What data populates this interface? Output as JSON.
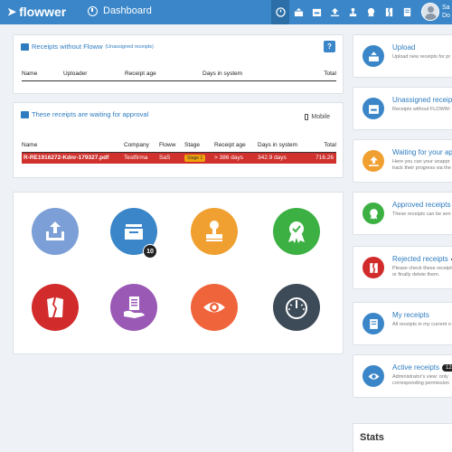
{
  "header": {
    "brand": "flowwer",
    "dashboard_label": "Dashboard",
    "nav_icons": [
      "dashboard-gauge-icon",
      "upload-box-icon",
      "inbox-icon",
      "upload-icon",
      "waiting-stamp-icon",
      "approved-award-icon",
      "rejected-receipt-icon",
      "documents-icon",
      "eye-icon"
    ],
    "user_line1": "Sa",
    "user_line2": "Do",
    "colors": {
      "bar": "#3a86c8",
      "active": "#2c6fa8"
    }
  },
  "unassigned_panel": {
    "title": "Receipts without Floww",
    "subtitle": "(Unassigned receipts)",
    "help_label": "?",
    "columns": [
      "Name",
      "Uploader",
      "Receipt age",
      "Days in system",
      "Total"
    ]
  },
  "approval_panel": {
    "title": "These receipts are waiting for approval",
    "mobile_label": "Mobile",
    "columns": [
      "Name",
      "Company",
      "Floww",
      "Stage",
      "Receipt age",
      "Days in system",
      "Total"
    ],
    "rows": [
      {
        "name": "R-RE1916272-Kdnr-179327.pdf",
        "company": "Testfirma",
        "floww": "SaS",
        "stage": "Stage 1",
        "receipt_age": "> 386 days",
        "days_in_system": "342.9 days",
        "total": "716.26"
      }
    ]
  },
  "circle_icons": [
    {
      "name": "upload",
      "color": "#7b9fd6"
    },
    {
      "name": "unassigned",
      "color": "#3a86c8",
      "badge": "10"
    },
    {
      "name": "waiting-stamp",
      "color": "#f0a030"
    },
    {
      "name": "approved-award",
      "color": "#3cb043"
    },
    {
      "name": "rejected-receipt",
      "color": "#d22b2b"
    },
    {
      "name": "my-receipts",
      "color": "#9b59b6"
    },
    {
      "name": "active-eye",
      "color": "#f0643c"
    },
    {
      "name": "stats-gauge",
      "color": "#3d4a57"
    }
  ],
  "cards": [
    {
      "title": "Upload",
      "desc": "Upload new receipts for pr",
      "color": "#3a86c8"
    },
    {
      "title": "Unassigned receipt",
      "desc": "Receipts without FLOWW-",
      "color": "#3a86c8"
    },
    {
      "title": "Waiting for your ap",
      "desc": "Here you can your unappr",
      "desc2": "track their progress via the",
      "color": "#f0a030"
    },
    {
      "title": "Approved receipts",
      "desc": "These receipts can be sen",
      "color": "#3cb043"
    },
    {
      "title": "Rejected receipts",
      "desc": "Please check these receipt",
      "desc2": "or finally delete them.",
      "color": "#d22b2b"
    },
    {
      "title": "My receipts",
      "desc": "All receipts in my current o",
      "color": "#3a86c8"
    },
    {
      "title": "Active receipts",
      "badge": "12",
      "desc": "Administrator's view: only",
      "desc2": "corresponding permission",
      "color": "#3a86c8"
    }
  ],
  "stats": {
    "title": "Stats"
  }
}
